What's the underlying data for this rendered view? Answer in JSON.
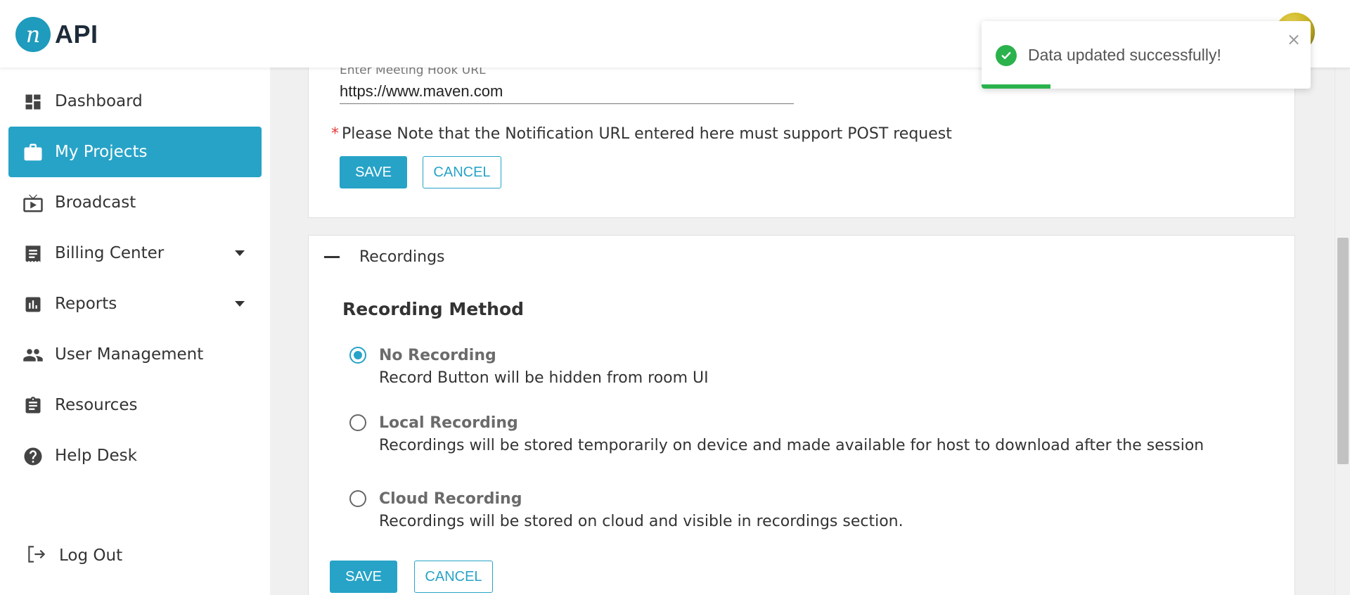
{
  "app": {
    "logo_mark": "n",
    "logo_text": "API"
  },
  "sidebar": {
    "items": [
      {
        "label": "Dashboard",
        "icon": "dashboard-icon",
        "active": false,
        "expandable": false
      },
      {
        "label": "My Projects",
        "icon": "briefcase-icon",
        "active": true,
        "expandable": false
      },
      {
        "label": "Broadcast",
        "icon": "broadcast-icon",
        "active": false,
        "expandable": false
      },
      {
        "label": "Billing Center",
        "icon": "receipt-icon",
        "active": false,
        "expandable": true
      },
      {
        "label": "Reports",
        "icon": "bar-chart-icon",
        "active": false,
        "expandable": true
      },
      {
        "label": "User Management",
        "icon": "users-icon",
        "active": false,
        "expandable": false
      },
      {
        "label": "Resources",
        "icon": "clipboard-icon",
        "active": false,
        "expandable": false
      },
      {
        "label": "Help Desk",
        "icon": "help-icon",
        "active": false,
        "expandable": false
      }
    ],
    "logout_label": "Log Out"
  },
  "hook": {
    "label": "Enter Meeting Hook URL",
    "value": "https://www.maven.com",
    "note_star": "*",
    "note": "Please Note that the Notification URL entered here must support POST request",
    "save_label": "SAVE",
    "cancel_label": "CANCEL"
  },
  "recordings": {
    "title": "Recordings",
    "method_title": "Recording Method",
    "options": [
      {
        "title": "No Recording",
        "desc": "Record Button will be hidden from room UI",
        "selected": true
      },
      {
        "title": "Local Recording",
        "desc": "Recordings will be stored temporarily on device and made available for host to download after the session",
        "selected": false
      },
      {
        "title": "Cloud Recording",
        "desc": "Recordings will be stored on cloud and visible in recordings section.",
        "selected": false
      }
    ],
    "save_label": "SAVE",
    "cancel_label": "CANCEL"
  },
  "toast": {
    "message": "Data updated successfully!",
    "close": "×",
    "progress": 0.21
  },
  "colors": {
    "accent": "#27a3c7",
    "success": "#2bb24c",
    "required": "#e53935"
  }
}
